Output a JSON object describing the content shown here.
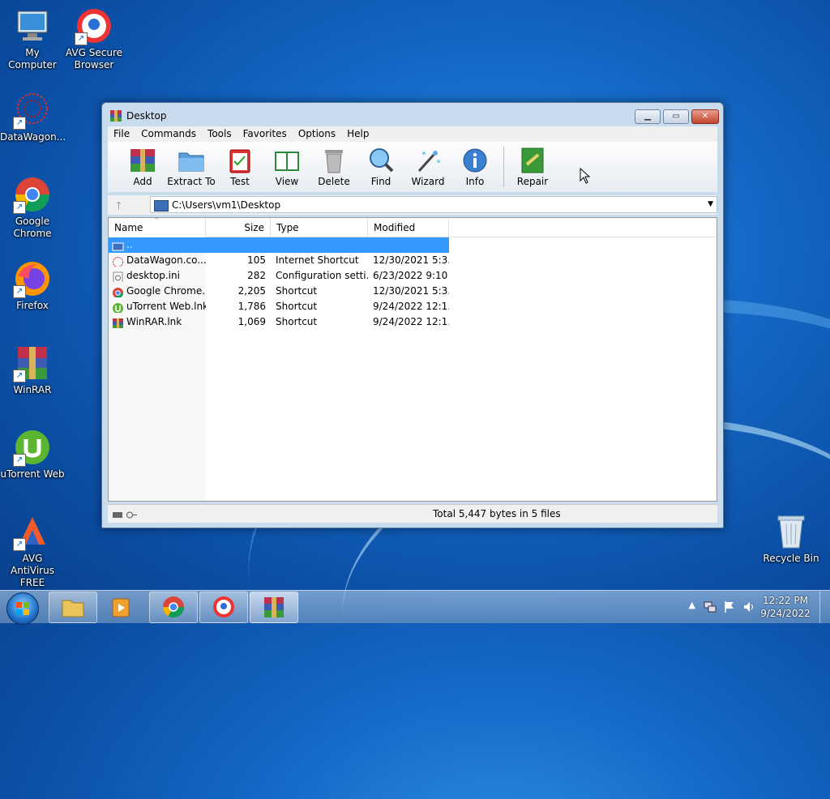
{
  "desktop_icons": [
    {
      "id": "my-computer",
      "label": "My Computer"
    },
    {
      "id": "avg-browser",
      "label": "AVG Secure Browser"
    },
    {
      "id": "datawagon",
      "label": "DataWagon..."
    },
    {
      "id": "google-chrome",
      "label": "Google Chrome"
    },
    {
      "id": "firefox",
      "label": "Firefox"
    },
    {
      "id": "winrar",
      "label": "WinRAR"
    },
    {
      "id": "utorrent",
      "label": "uTorrent Web"
    },
    {
      "id": "avg-antivirus",
      "label": "AVG AntiVirus FREE"
    },
    {
      "id": "recycle-bin",
      "label": "Recycle Bin"
    }
  ],
  "window": {
    "title": "Desktop",
    "menu": [
      "File",
      "Commands",
      "Tools",
      "Favorites",
      "Options",
      "Help"
    ],
    "toolbar": [
      "Add",
      "Extract To",
      "Test",
      "View",
      "Delete",
      "Find",
      "Wizard",
      "Info",
      "Repair"
    ],
    "address": "C:\\Users\\vm1\\Desktop",
    "columns": [
      "Name",
      "Size",
      "Type",
      "Modified"
    ],
    "parent_row": "..",
    "rows": [
      {
        "name": "DataWagon.co...",
        "size": "105",
        "type": "Internet Shortcut",
        "modified": "12/30/2021 5:3..."
      },
      {
        "name": "desktop.ini",
        "size": "282",
        "type": "Configuration setti...",
        "modified": "6/23/2022 9:10 ..."
      },
      {
        "name": "Google Chrome....",
        "size": "2,205",
        "type": "Shortcut",
        "modified": "12/30/2021 5:3..."
      },
      {
        "name": "uTorrent Web.lnk",
        "size": "1,786",
        "type": "Shortcut",
        "modified": "9/24/2022 12:1..."
      },
      {
        "name": "WinRAR.lnk",
        "size": "1,069",
        "type": "Shortcut",
        "modified": "9/24/2022 12:1..."
      }
    ],
    "status": "Total 5,447 bytes in 5 files"
  },
  "taskbar": {
    "time": "12:22 PM",
    "date": "9/24/2022"
  }
}
